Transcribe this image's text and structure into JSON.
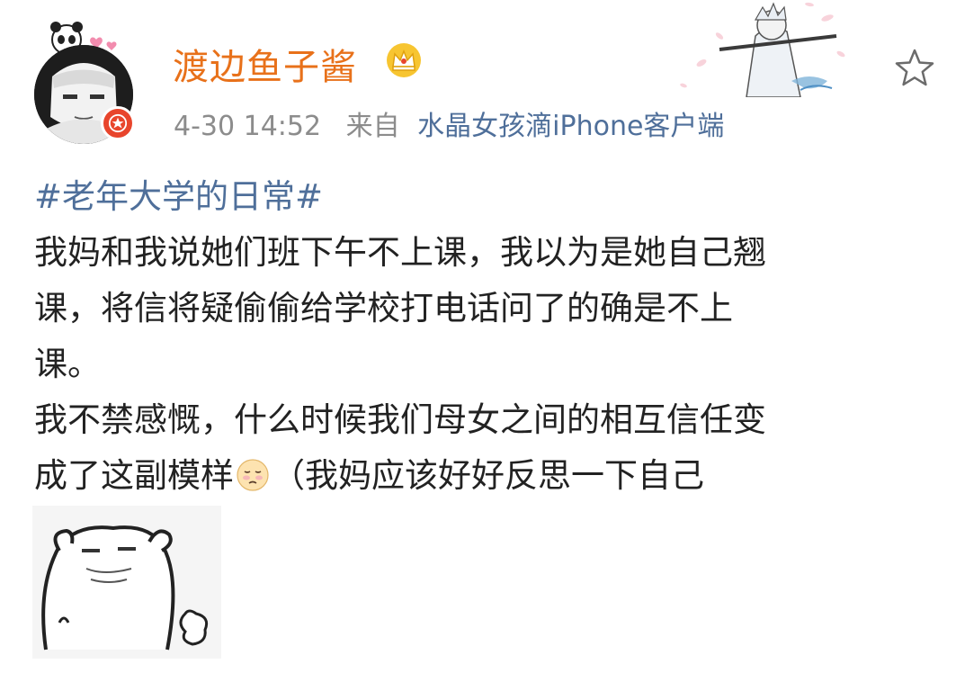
{
  "user": {
    "name": "渡边鱼子酱",
    "post_time": "4-30 14:52",
    "source_prefix": "来自",
    "source_client": "水晶女孩滴iPhone客户端"
  },
  "post": {
    "topic": "#老年大学的日常#",
    "lines": [
      "我妈和我说她们班下午不上课，我以为是她自己翘",
      "课，将信将疑偷偷给学校打电话问了的确是不上",
      "课。",
      "我不禁感慨，什么时候我们母女之间的相互信任变"
    ],
    "last_line_before_emoji": "成了这副模样",
    "last_line_after_emoji": "（我妈应该好好反思一下自己"
  },
  "icons": {
    "verified_badge": "verified-star-badge-icon",
    "crown": "vip-crown-icon",
    "favorite": "star-outline-icon",
    "emoji": "sad-face-emoji"
  },
  "colors": {
    "username": "#e8711a",
    "link": "#4f6f9a",
    "meta": "#8c8c8c",
    "badge": "#e8452c"
  }
}
